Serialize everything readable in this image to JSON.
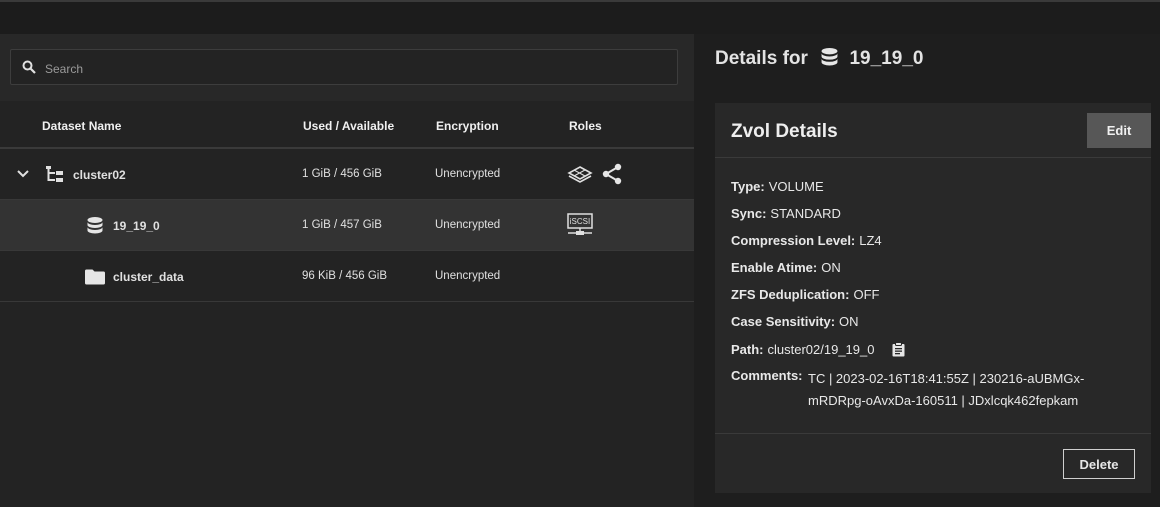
{
  "search": {
    "placeholder": "Search"
  },
  "table": {
    "columns": [
      "Dataset Name",
      "Used / Available",
      "Encryption",
      "Roles"
    ],
    "rows": [
      {
        "name": "cluster02",
        "used": "1 GiB / 456 GiB",
        "encryption": "Unencrypted",
        "icon": "dataset-tree-icon",
        "roles": [
          "layers-icon",
          "share-icon"
        ],
        "expanded": true
      },
      {
        "name": "19_19_0",
        "used": "1 GiB / 457 GiB",
        "encryption": "Unencrypted",
        "icon": "zvol-database-icon",
        "roles": [
          "iscsi-icon"
        ],
        "selected": true
      },
      {
        "name": "cluster_data",
        "used": "96 KiB / 456 GiB",
        "encryption": "Unencrypted",
        "icon": "folder-icon",
        "roles": []
      }
    ]
  },
  "details": {
    "title_prefix": "Details for",
    "title_name": "19_19_0",
    "card_title": "Zvol Details",
    "edit_label": "Edit",
    "delete_label": "Delete",
    "props": [
      {
        "label": "Type:",
        "value": "VOLUME"
      },
      {
        "label": "Sync:",
        "value": "STANDARD"
      },
      {
        "label": "Compression Level:",
        "value": "LZ4"
      },
      {
        "label": "Enable Atime:",
        "value": "ON"
      },
      {
        "label": "ZFS Deduplication:",
        "value": "OFF"
      },
      {
        "label": "Case Sensitivity:",
        "value": "ON"
      },
      {
        "label": "Path:",
        "value": "cluster02/19_19_0"
      }
    ],
    "comments_label": "Comments:",
    "comments_value": "TC | 2023-02-16T18:41:55Z | 230216-aUBMGx-mRDRpg-oAvxDa-160511 | JDxlcqk462fepkam"
  },
  "colors": {
    "background": "#1e1e1e",
    "panel": "#282828",
    "selected_row": "#333333"
  }
}
